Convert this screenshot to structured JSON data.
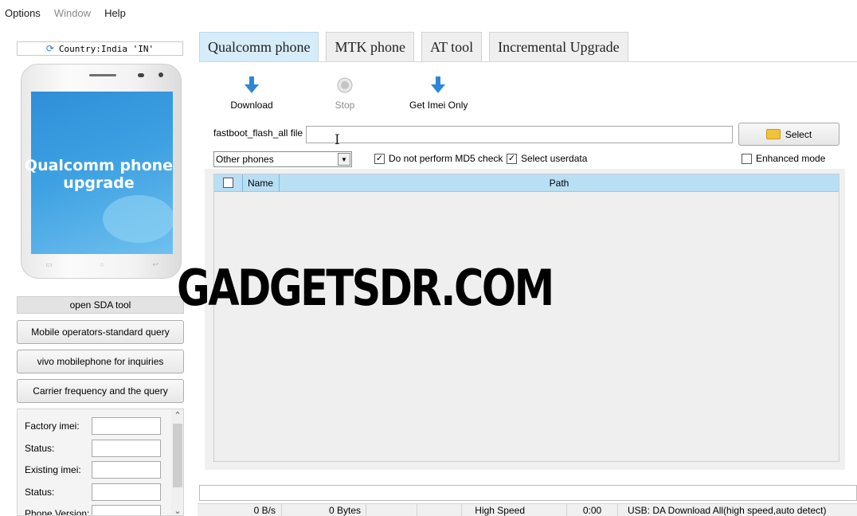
{
  "menu": {
    "options": "Options",
    "window": "Window",
    "help": "Help"
  },
  "left": {
    "country": "Country:India 'IN'",
    "phone_title": "Qualcomm phone\nupgrade",
    "sda_button": "open SDA tool",
    "buttons": [
      "Mobile operators-standard query",
      "vivo mobilephone for inquiries",
      "Carrier frequency and the query"
    ],
    "info_rows": [
      {
        "label": "Factory imei:",
        "value": ""
      },
      {
        "label": "Status:",
        "value": ""
      },
      {
        "label": "Existing imei:",
        "value": ""
      },
      {
        "label": "Status:",
        "value": ""
      },
      {
        "label": "Phone Version:",
        "value": ""
      }
    ]
  },
  "tabs": [
    "Qualcomm phone",
    "MTK phone",
    "AT tool",
    "Incremental Upgrade"
  ],
  "toolbar": {
    "download": "Download",
    "stop": "Stop",
    "get_imei": "Get Imei Only"
  },
  "flash": {
    "label": "fastboot_flash_all file",
    "value": "",
    "select": "Select"
  },
  "options": {
    "phone_type": "Other phones",
    "no_md5": "Do not perform MD5 check",
    "no_md5_checked": true,
    "select_userdata": "Select userdata",
    "select_userdata_checked": true,
    "enhanced": "Enhanced mode",
    "enhanced_checked": false
  },
  "grid": {
    "col_name": "Name",
    "col_path": "Path",
    "rows": []
  },
  "status": {
    "speed": "0 B/s",
    "bytes": "0 Bytes",
    "mode": "High Speed",
    "time": "0:00",
    "usb": "USB: DA Download All(high speed,auto detect)"
  },
  "watermark": "GADGETSDR.COM",
  "colors": {
    "tab_active": "#d6ecf9",
    "grid_header": "#b8dff4",
    "arrow_blue": "#2f86d6"
  }
}
